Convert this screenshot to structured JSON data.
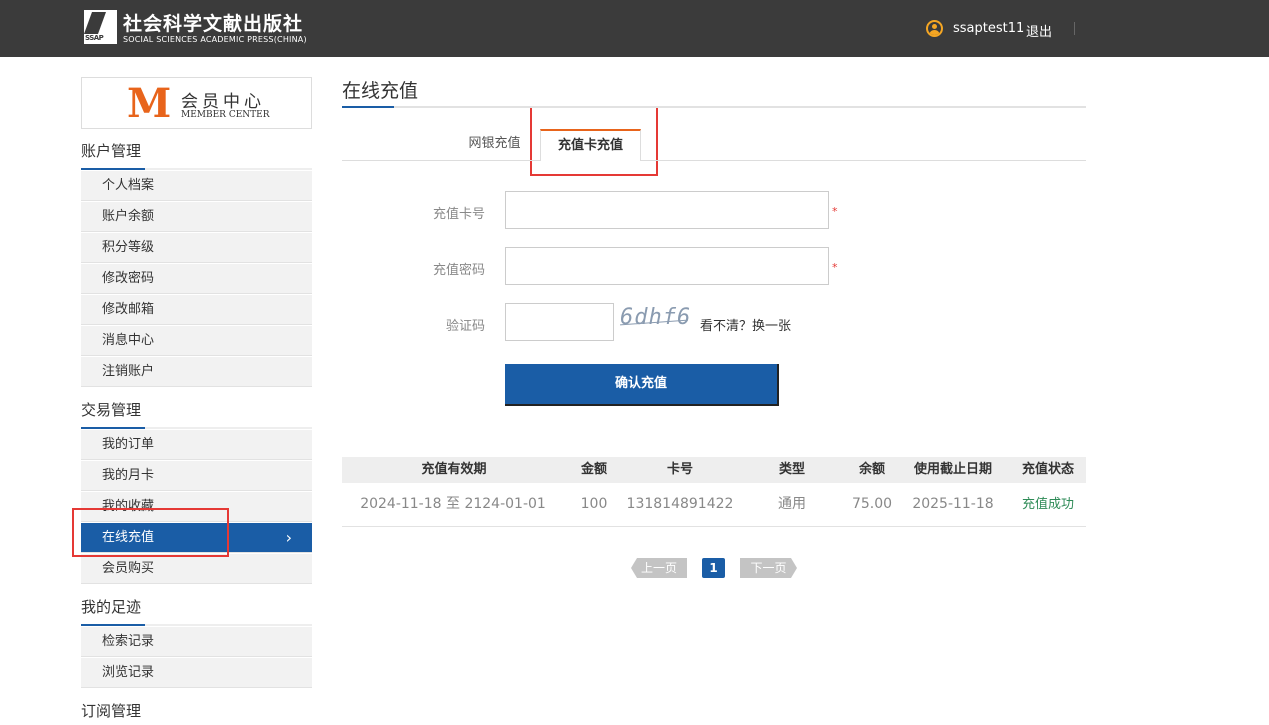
{
  "header": {
    "logo_abbr": "SSAP",
    "logo_cn": "社会科学文献出版社",
    "logo_en": "SOCIAL SCIENCES ACADEMIC PRESS(CHINA)",
    "username": "ssaptest11",
    "logout": "退出"
  },
  "member": {
    "letter": "M",
    "cn": "会员中心",
    "en": "MEMBER CENTER"
  },
  "sidebar": {
    "sections": [
      {
        "title": "账户管理",
        "items": [
          "个人档案",
          "账户余额",
          "积分等级",
          "修改密码",
          "修改邮箱",
          "消息中心",
          "注销账户"
        ]
      },
      {
        "title": "交易管理",
        "items": [
          "我的订单",
          "我的月卡",
          "我的收藏",
          "在线充值",
          "会员购买"
        ]
      },
      {
        "title": "我的足迹",
        "items": [
          "检索记录",
          "浏览记录"
        ]
      },
      {
        "title": "订阅管理",
        "items": []
      }
    ],
    "active_item": "在线充值",
    "active_chevron": "›"
  },
  "main": {
    "title": "在线充值",
    "tabs": [
      {
        "label": "网银充值",
        "active": false
      },
      {
        "label": "充值卡充值",
        "active": true
      }
    ],
    "form": {
      "card_no_label": "充值卡号",
      "card_no_value": "",
      "password_label": "充值密码",
      "password_value": "",
      "captcha_label": "验证码",
      "captcha_value": "",
      "captcha_image_text": "6dhf6",
      "captcha_refresh": "看不清？换一张",
      "required_mark": "*",
      "submit_label": "确认充值"
    },
    "table": {
      "headers": [
        "充值有效期",
        "金额",
        "卡号",
        "类型",
        "余额",
        "使用截止日期",
        "充值状态"
      ],
      "rows": [
        [
          "2024-11-18 至 2124-01-01",
          "100",
          "131814891422",
          "通用",
          "75.00",
          "2025-11-18",
          "充值成功"
        ]
      ]
    },
    "pagination": {
      "prev": "上一页",
      "current": "1",
      "next": "下一页"
    }
  },
  "colors": {
    "topbar": "#3b3b3b",
    "accent_blue": "#1a5da6",
    "accent_orange": "#e8641b",
    "success_green": "#2e8b57",
    "highlight_red": "#e53935"
  }
}
